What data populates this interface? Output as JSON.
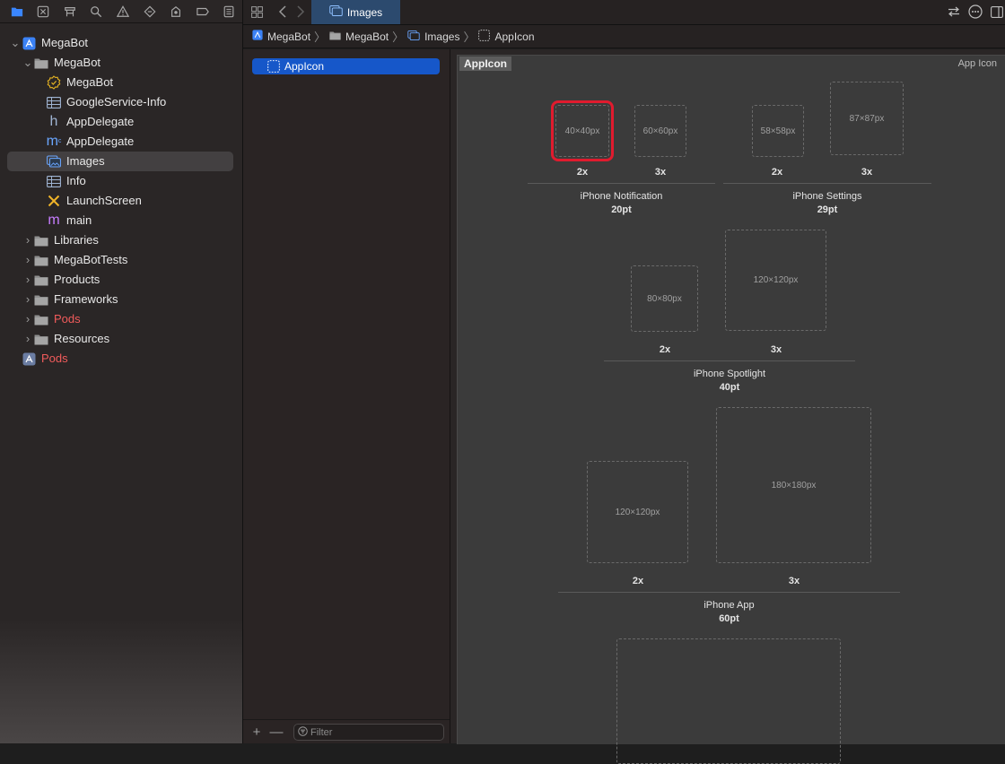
{
  "navigator": {
    "toolbar": [
      "folder-icon",
      "source-control-icon",
      "symbol-icon",
      "search-icon",
      "warning-icon",
      "test-icon",
      "debug-icon",
      "breakpoint-icon",
      "report-icon"
    ],
    "tree": [
      {
        "label": "MegaBot",
        "icon": "project-icon",
        "level": 0,
        "expanded": true
      },
      {
        "label": "MegaBot",
        "icon": "folder-icon",
        "level": 1,
        "expanded": true
      },
      {
        "label": "MegaBot",
        "icon": "entitlements-icon",
        "level": 2
      },
      {
        "label": "GoogleService-Info",
        "icon": "plist-icon",
        "level": 2
      },
      {
        "label": "AppDelegate",
        "icon": "header-file-icon",
        "level": 2
      },
      {
        "label": "AppDelegate",
        "icon": "objc-file-icon",
        "level": 2
      },
      {
        "label": "Images",
        "icon": "asset-catalog-icon",
        "level": 2,
        "selected": true
      },
      {
        "label": "Info",
        "icon": "plist-icon",
        "level": 2
      },
      {
        "label": "LaunchScreen",
        "icon": "storyboard-icon",
        "level": 2
      },
      {
        "label": "main",
        "icon": "objc-file-icon",
        "level": 2
      },
      {
        "label": "Libraries",
        "icon": "folder-icon",
        "level": 1,
        "expanded": false
      },
      {
        "label": "MegaBotTests",
        "icon": "folder-icon",
        "level": 1,
        "expanded": false
      },
      {
        "label": "Products",
        "icon": "folder-icon",
        "level": 1,
        "expanded": false
      },
      {
        "label": "Frameworks",
        "icon": "folder-icon",
        "level": 1,
        "expanded": false
      },
      {
        "label": "Pods",
        "icon": "folder-icon",
        "level": 1,
        "expanded": false,
        "red": true
      },
      {
        "label": "Resources",
        "icon": "folder-icon",
        "level": 1,
        "expanded": false
      },
      {
        "label": "Pods",
        "icon": "project-icon",
        "level": 0,
        "red": true
      }
    ]
  },
  "tab": {
    "label": "Images"
  },
  "breadcrumb": [
    "MegaBot",
    "MegaBot",
    "Images",
    "AppIcon"
  ],
  "asset_list": {
    "items": [
      "AppIcon"
    ],
    "filter_placeholder": "Filter",
    "add_label": "+",
    "remove_label": "—"
  },
  "editor": {
    "title": "AppIcon",
    "type": "App Icon",
    "slots": {
      "notif_2x": "40×40px",
      "notif_3x": "60×60px",
      "settings_2x": "58×58px",
      "settings_3x": "87×87px",
      "spot_2x": "80×80px",
      "spot_3x": "120×120px",
      "app_2x": "120×120px",
      "app_3x": "180×180px",
      "next": ""
    },
    "scales": {
      "two": "2x",
      "three": "3x"
    },
    "groups": {
      "notification": {
        "name": "iPhone Notification",
        "size": "20pt"
      },
      "settings": {
        "name": "iPhone Settings",
        "size": "29pt"
      },
      "spotlight": {
        "name": "iPhone Spotlight",
        "size": "40pt"
      },
      "app": {
        "name": "iPhone App",
        "size": "60pt"
      }
    }
  },
  "colors": {
    "selection": "#1657c9",
    "tab_active": "#2c4a6e",
    "highlight": "#e01b2e",
    "red_item": "#f15b5b"
  }
}
